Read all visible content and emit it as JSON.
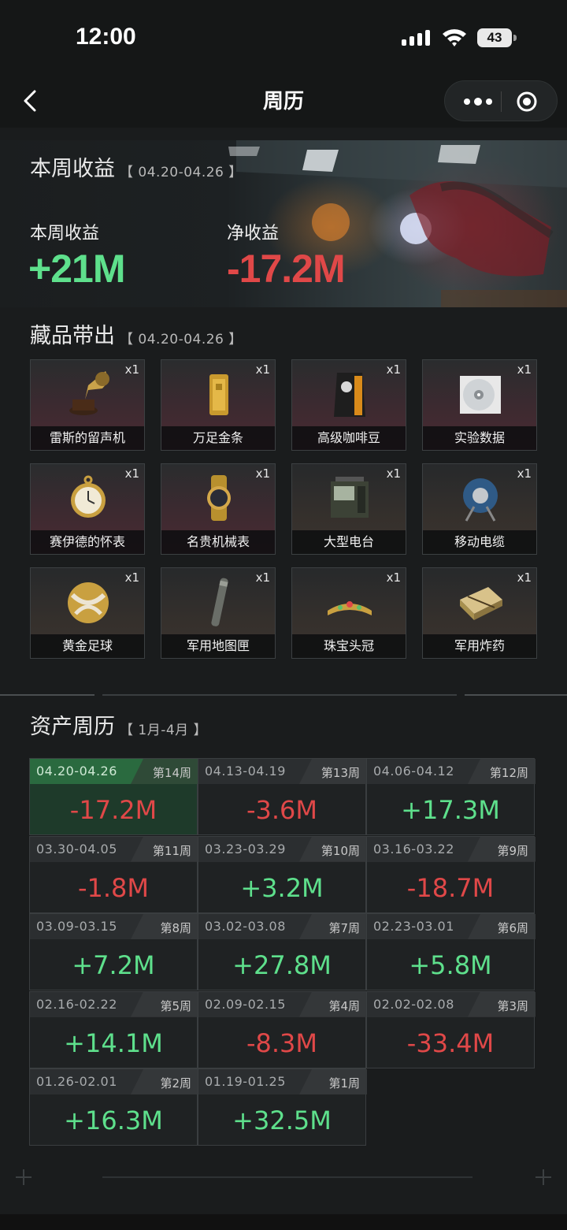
{
  "status_bar": {
    "time": "12:00",
    "battery": "43"
  },
  "nav": {
    "title": "周历"
  },
  "weekly": {
    "title": "本周收益",
    "range": "【 04.20-04.26 】",
    "income_label": "本周收益",
    "income_value": "+21M",
    "net_label": "净收益",
    "net_value": "-17.2M"
  },
  "collection": {
    "title": "藏品带出",
    "range": "【 04.20-04.26 】",
    "items": [
      {
        "name": "雷斯的留声机",
        "qty": "x1",
        "icon": "gramophone-icon"
      },
      {
        "name": "万足金条",
        "qty": "x1",
        "icon": "gold-bar-icon"
      },
      {
        "name": "高级咖啡豆",
        "qty": "x1",
        "icon": "coffee-bag-icon"
      },
      {
        "name": "实验数据",
        "qty": "x1",
        "icon": "disc-icon"
      },
      {
        "name": "赛伊德的怀表",
        "qty": "x1",
        "icon": "pocket-watch-icon"
      },
      {
        "name": "名贵机械表",
        "qty": "x1",
        "icon": "wristwatch-icon"
      },
      {
        "name": "大型电台",
        "qty": "x1",
        "icon": "radio-station-icon"
      },
      {
        "name": "移动电缆",
        "qty": "x1",
        "icon": "cable-reel-icon"
      },
      {
        "name": "黄金足球",
        "qty": "x1",
        "icon": "golden-ball-icon"
      },
      {
        "name": "军用地图匣",
        "qty": "x1",
        "icon": "map-tube-icon"
      },
      {
        "name": "珠宝头冠",
        "qty": "x1",
        "icon": "tiara-icon"
      },
      {
        "name": "军用炸药",
        "qty": "x1",
        "icon": "explosives-icon"
      }
    ]
  },
  "calendar": {
    "title": "资产周历",
    "range": "【 1月-4月 】",
    "weeks": [
      {
        "range": "04.20-04.26",
        "week": "第14周",
        "value": "-17.2M",
        "sign": "neg",
        "current": true
      },
      {
        "range": "04.13-04.19",
        "week": "第13周",
        "value": "-3.6M",
        "sign": "neg"
      },
      {
        "range": "04.06-04.12",
        "week": "第12周",
        "value": "+17.3M",
        "sign": "pos"
      },
      {
        "range": "03.30-04.05",
        "week": "第11周",
        "value": "-1.8M",
        "sign": "neg"
      },
      {
        "range": "03.23-03.29",
        "week": "第10周",
        "value": "+3.2M",
        "sign": "pos"
      },
      {
        "range": "03.16-03.22",
        "week": "第9周",
        "value": "-18.7M",
        "sign": "neg"
      },
      {
        "range": "03.09-03.15",
        "week": "第8周",
        "value": "+7.2M",
        "sign": "pos"
      },
      {
        "range": "03.02-03.08",
        "week": "第7周",
        "value": "+27.8M",
        "sign": "pos"
      },
      {
        "range": "02.23-03.01",
        "week": "第6周",
        "value": "+5.8M",
        "sign": "pos"
      },
      {
        "range": "02.16-02.22",
        "week": "第5周",
        "value": "+14.1M",
        "sign": "pos"
      },
      {
        "range": "02.09-02.15",
        "week": "第4周",
        "value": "-8.3M",
        "sign": "neg"
      },
      {
        "range": "02.02-02.08",
        "week": "第3周",
        "value": "-33.4M",
        "sign": "neg"
      },
      {
        "range": "01.26-02.01",
        "week": "第2周",
        "value": "+16.3M",
        "sign": "pos"
      },
      {
        "range": "01.19-01.25",
        "week": "第1周",
        "value": "+32.5M",
        "sign": "pos"
      }
    ]
  },
  "colors": {
    "positive": "#5ee08c",
    "negative": "#e04848",
    "current_week": "#2a6a3f"
  }
}
